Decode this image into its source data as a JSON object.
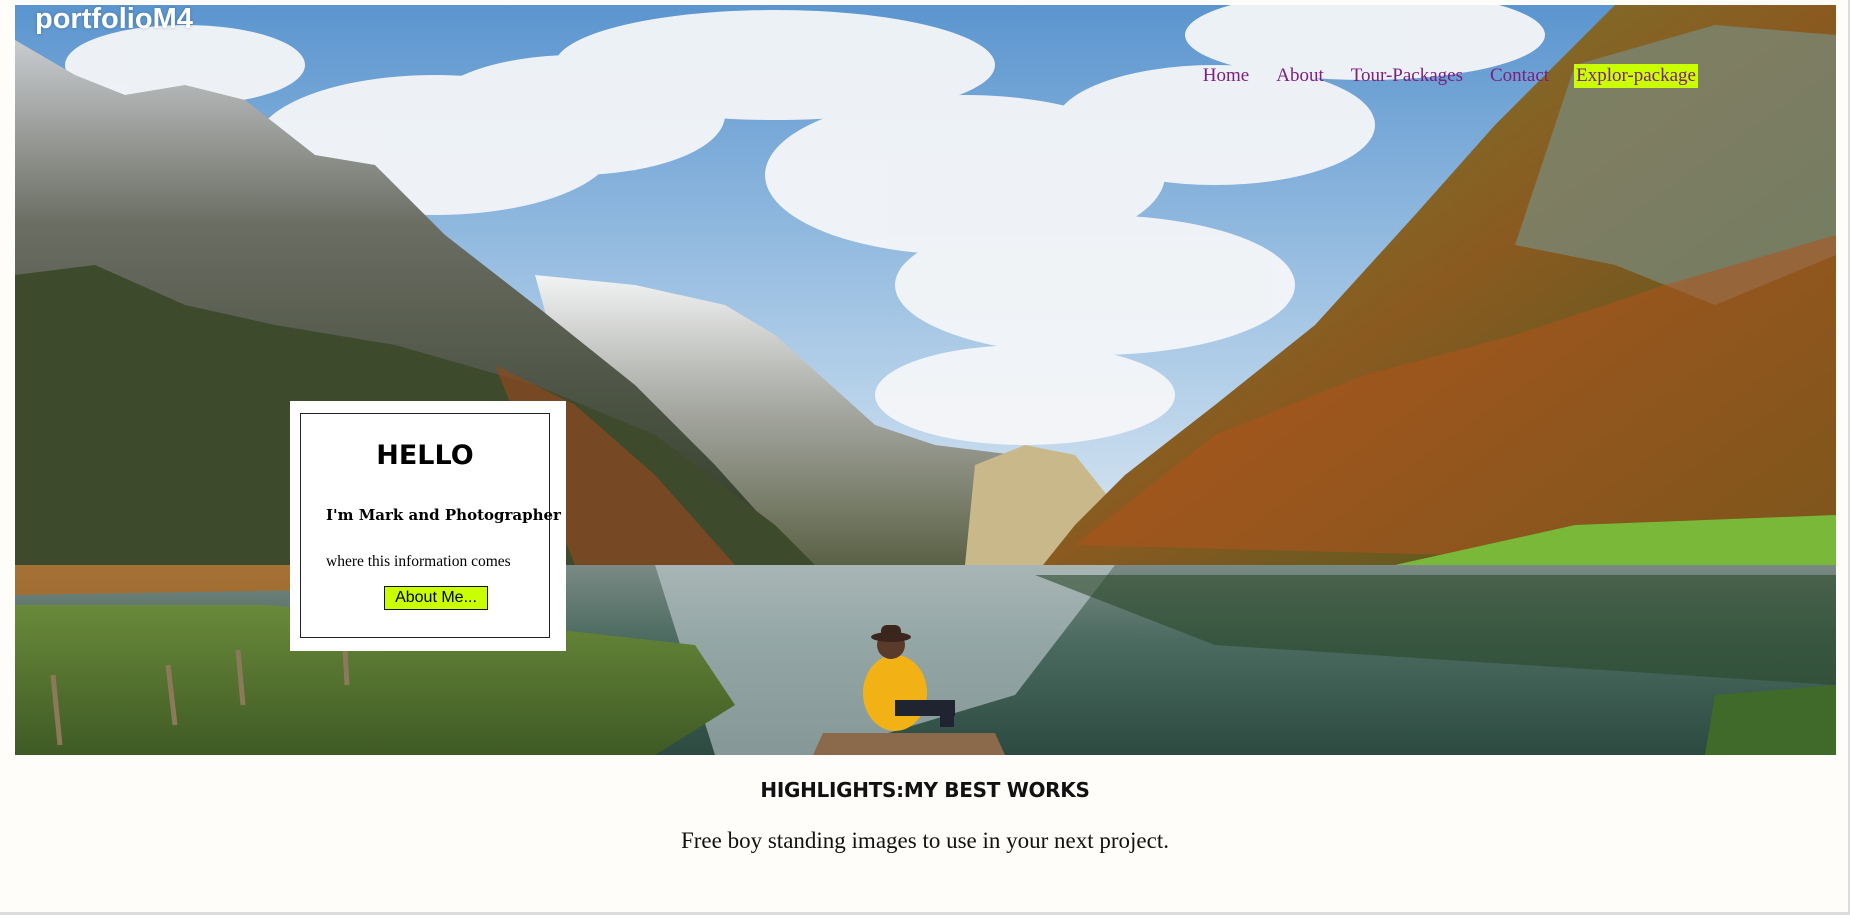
{
  "brand": "portfolioM4",
  "nav": {
    "items": [
      "Home",
      "About",
      "Tour-Packages",
      "Contact",
      "Explor-package"
    ],
    "active_index": 4,
    "link_color": "#7b1f80",
    "active_bg": "#c9ff00"
  },
  "hero": {
    "image": "mountain-lake-photo"
  },
  "hello_card": {
    "title": "HELLO",
    "subtitle": "I'm Mark and Photographer",
    "info": "where this information comes",
    "button_label": "About Me..."
  },
  "highlights": {
    "heading": "HIGHLIGHTS:MY BEST WORKS",
    "tagline": "Free boy standing images to use in your next project."
  },
  "colors": {
    "accent": "#c9ff00",
    "page_bg": "#fefdf9"
  }
}
